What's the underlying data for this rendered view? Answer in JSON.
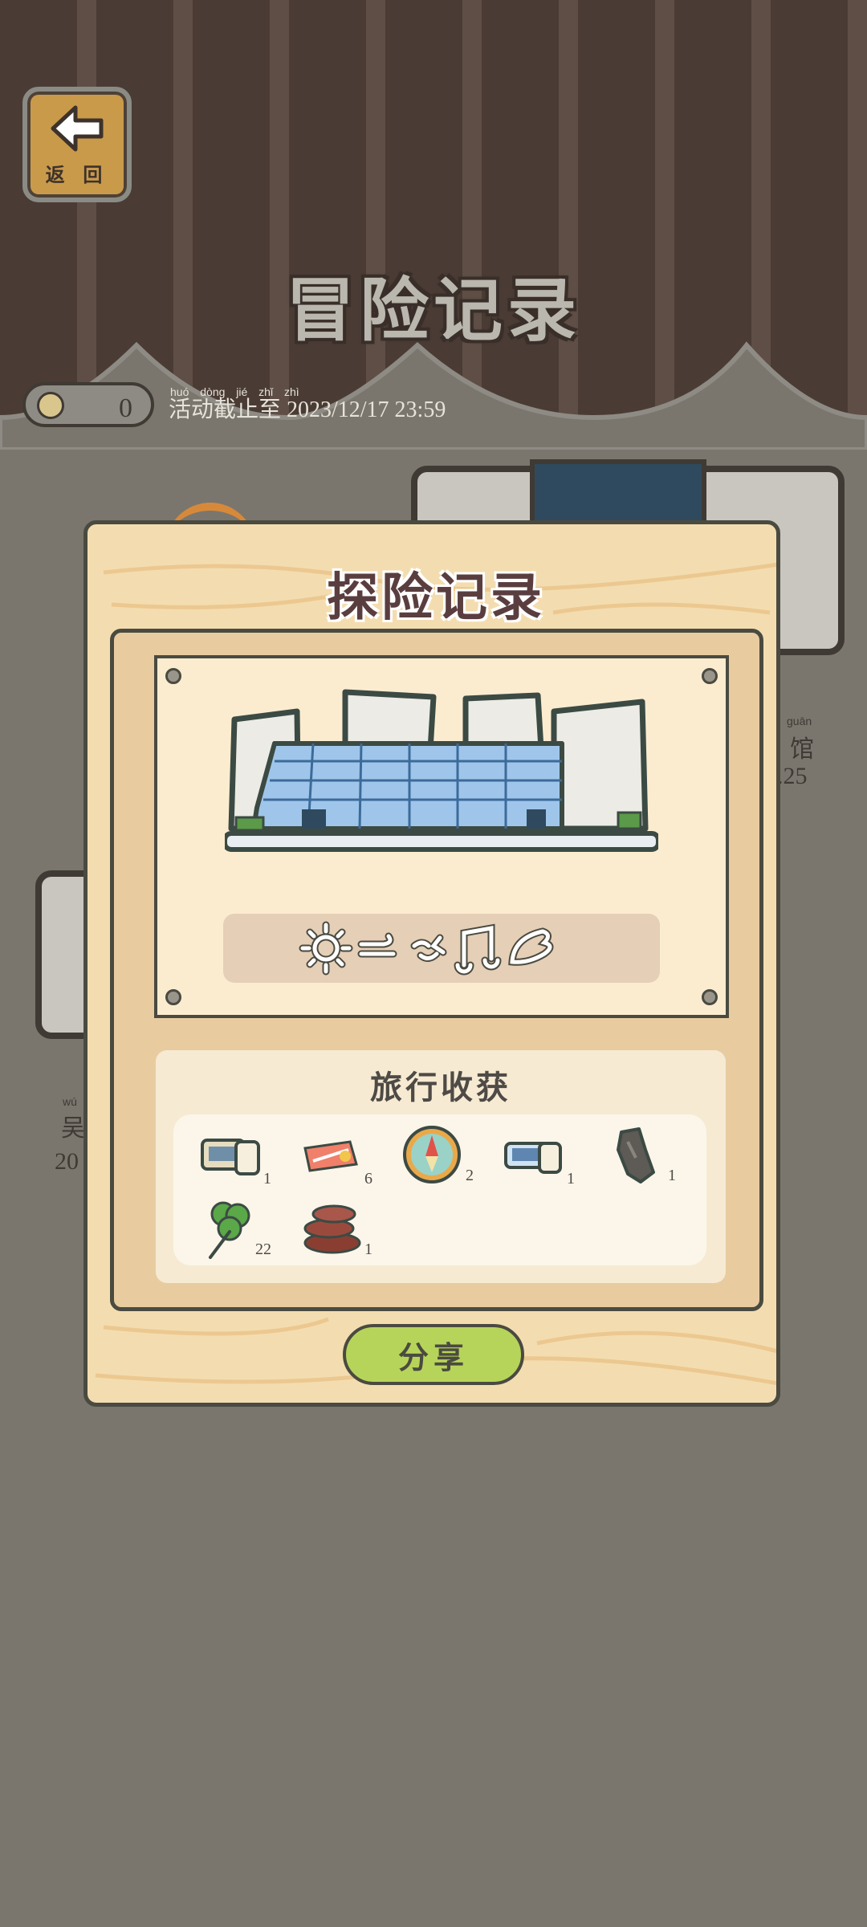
{
  "header": {
    "back_label": "返 回",
    "title": "冒险记录"
  },
  "counter": {
    "clover_count": "0"
  },
  "event": {
    "pinyin": "huó dòng jié zhǐ zhì",
    "deadline": "活动截止至 2023/12/17 23:59"
  },
  "background": {
    "right_card_pinyin": "guān",
    "right_card_label": "馆",
    "right_card_date": ".25",
    "left_card_pinyin": "wú",
    "left_card_label": "吴",
    "left_card_date": "20"
  },
  "modal": {
    "title": "探险记录",
    "mood_icons": [
      "sun-icon",
      "wind-icon",
      "smile-icon",
      "music-note-icon",
      "wing-icon"
    ],
    "harvest_title": "旅行收获",
    "items": [
      {
        "name": "ticket-icon",
        "qty": "1"
      },
      {
        "name": "red-card-icon",
        "qty": "6"
      },
      {
        "name": "compass-icon",
        "qty": "2"
      },
      {
        "name": "ticket-blue-icon",
        "qty": "1"
      },
      {
        "name": "rock-icon",
        "qty": "1"
      },
      {
        "name": "clover-icon",
        "qty": "22"
      },
      {
        "name": "wood-stack-icon",
        "qty": "1"
      }
    ],
    "share_label": "分享"
  },
  "colors": {
    "panel_wood": "#f3ddb0",
    "share_green": "#b7d45a",
    "outline": "#4a4a40"
  }
}
